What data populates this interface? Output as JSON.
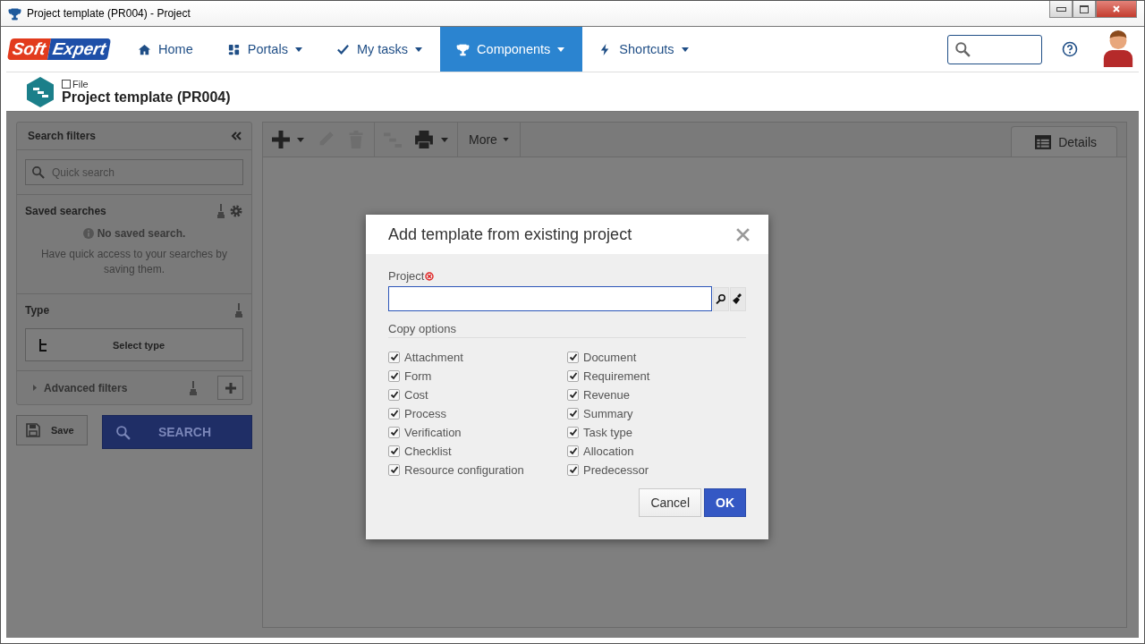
{
  "window": {
    "title": "Project template (PR004) - Project"
  },
  "logo": {
    "part_1": "Soft",
    "part_2": "Expert"
  },
  "nav": [
    {
      "label": "Home",
      "selected": false,
      "dropdown": false
    },
    {
      "label": "Portals",
      "selected": false,
      "dropdown": true
    },
    {
      "label": "My tasks",
      "selected": false,
      "dropdown": true
    },
    {
      "label": "Components",
      "selected": true,
      "dropdown": true
    },
    {
      "label": "Shortcuts",
      "selected": false,
      "dropdown": true
    }
  ],
  "header": {
    "breadcrumb": "File",
    "title": "Project template (PR004)"
  },
  "filters": {
    "title": "Search filters",
    "quick_search_placeholder": "Quick search",
    "saved_title": "Saved searches",
    "no_saved": "No saved search.",
    "saved_hint": "Have quick access to your searches by saving them.",
    "type_title": "Type",
    "select_type": "Select type",
    "advanced": "Advanced filters",
    "save": "Save",
    "search": "SEARCH"
  },
  "toolbar": {
    "more": "More",
    "details_tab": "Details"
  },
  "dialog": {
    "title": "Add template from existing project",
    "project_label": "Project",
    "copy_options_label": "Copy options",
    "options": [
      {
        "label": "Attachment",
        "checked": true
      },
      {
        "label": "Document",
        "checked": true
      },
      {
        "label": "Form",
        "checked": true
      },
      {
        "label": "Requirement",
        "checked": true
      },
      {
        "label": "Cost",
        "checked": true
      },
      {
        "label": "Revenue",
        "checked": true
      },
      {
        "label": "Process",
        "checked": true
      },
      {
        "label": "Summary",
        "checked": true
      },
      {
        "label": "Verification",
        "checked": true
      },
      {
        "label": "Task type",
        "checked": true
      },
      {
        "label": "Checklist",
        "checked": true
      },
      {
        "label": "Allocation",
        "checked": true
      },
      {
        "label": "Resource configuration",
        "checked": true
      },
      {
        "label": "Predecessor",
        "checked": true
      }
    ],
    "buttons": [
      "Cancel",
      "OK"
    ]
  }
}
